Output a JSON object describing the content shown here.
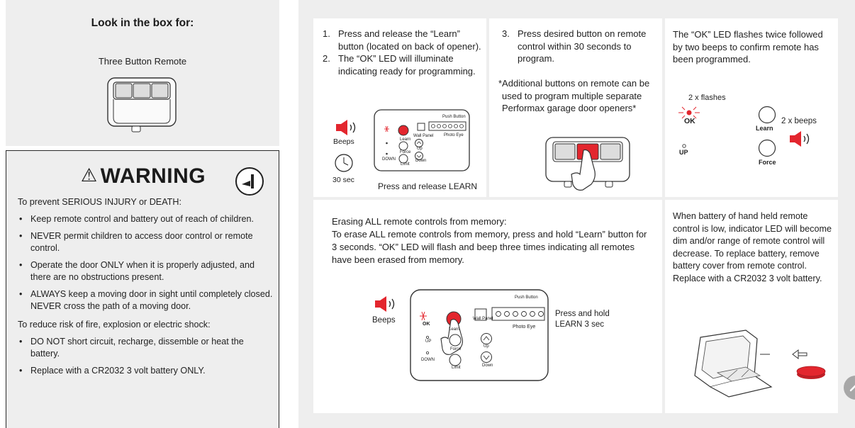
{
  "box": {
    "title": "Look in the box for:",
    "subtitle": "Three Button Remote"
  },
  "warning": {
    "title": "WARNING",
    "triangle_icon": "warning-triangle-icon",
    "door_icon": "door-icon",
    "intro1": "To prevent SERIOUS INJURY or DEATH:",
    "list1": [
      "Keep remote control and battery out of reach of children.",
      "NEVER permit children to access door control or remote control.",
      "Operate the door ONLY when it is properly adjusted, and there are no obstructions present.",
      "ALWAYS keep a moving door in sight until completely closed. NEVER cross the path of a moving door."
    ],
    "intro2": "To reduce risk of fire, explosion or electric shock:",
    "list2": [
      "DO NOT short circuit, recharge, dissemble or heat the battery.",
      "Replace with a CR2032 3 volt battery ONLY."
    ]
  },
  "step1": {
    "items": [
      {
        "num": "1.",
        "text": "Press and release the “Learn” button (located on back of opener)."
      },
      {
        "num": "2.",
        "text": "The “OK” LED will illuminate indicating ready for programming."
      }
    ],
    "beeps": "Beeps",
    "timer": "30 sec",
    "caption": "Press and release LEARN",
    "board": {
      "push_button": "Push Button",
      "wall_panel": "Wall Panel",
      "photo_eye": "Photo Eye",
      "learn": "Learn",
      "up": "Up",
      "force": "Force",
      "down_led": "DOWN",
      "limit": "Limit",
      "down": "Down"
    }
  },
  "step3": {
    "num": "3.",
    "text": "Press desired button on remote control within 30 seconds to program.",
    "note": "*Additional buttons on remote can be used to program multiple separate Performax garage door openers*"
  },
  "confirm": {
    "text": "The “OK” LED flashes twice followed by two beeps to confirm remote has been programmed.",
    "flashes": "2 x flashes",
    "beeps": "2 x beeps",
    "ok": "OK",
    "learn": "Learn",
    "up": "UP",
    "force": "Force"
  },
  "erase": {
    "title": "Erasing ALL remote controls from memory:",
    "text": "To erase ALL remote controls from memory, press and hold “Learn” button for 3 seconds. “OK” LED will flash and beep three times indicating all remotes have been erased from memory.",
    "beeps": "Beeps",
    "caption_line1": "Press and hold",
    "caption_line2": "LEARN 3 sec",
    "board": {
      "push_button": "Push Button",
      "wall_panel": "Wall Panel",
      "photo_eye": "Photo Eye",
      "ok": "OK",
      "learn": "Learn",
      "up_led": "UP",
      "force": "Force",
      "up": "Up",
      "down_led": "DOWN",
      "limit": "Limit",
      "down": "Down"
    }
  },
  "battery": {
    "text": "When battery of hand held remote control is low, indicator LED will become dim and/or range of remote control will decrease. To replace battery, remove battery cover from remote control. Replace with a CR2032 3 volt battery."
  },
  "colors": {
    "accent_red": "#e3262e",
    "panel_bg": "#eeeeee"
  }
}
